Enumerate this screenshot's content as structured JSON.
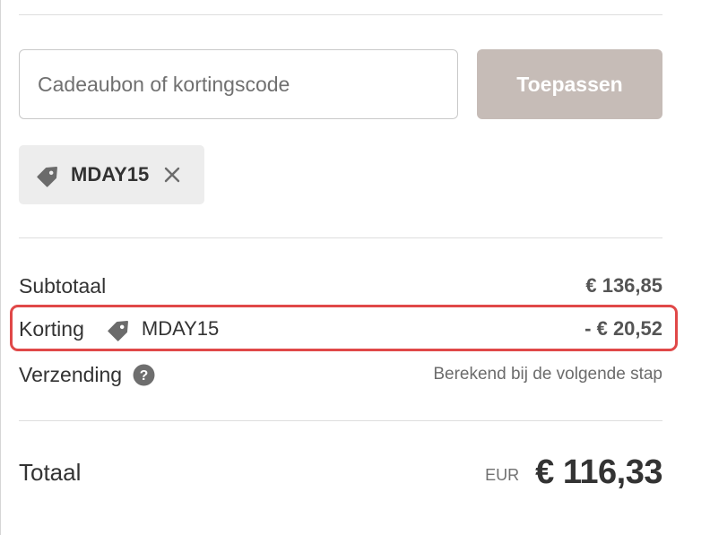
{
  "discount_form": {
    "input_placeholder": "Cadeaubon of kortingscode",
    "apply_label": "Toepassen"
  },
  "applied_code": {
    "code": "MDAY15",
    "tag_icon": "tag-icon",
    "remove_icon": "close-icon"
  },
  "summary": {
    "subtotal_label": "Subtotaal",
    "subtotal_value": "€ 136,85",
    "discount_label": "Korting",
    "discount_code": "MDAY15",
    "discount_value": "- € 20,52",
    "shipping_label": "Verzending",
    "shipping_icon": "help-icon",
    "shipping_note": "Berekend bij de volgende stap",
    "total_label": "Totaal",
    "total_currency": "EUR",
    "total_value": "€ 116,33"
  },
  "colors": {
    "apply_button": "#c6bcb7",
    "highlight_border": "#e04848",
    "chip_background": "#ededed",
    "tag_icon": "#6b6b6b"
  }
}
